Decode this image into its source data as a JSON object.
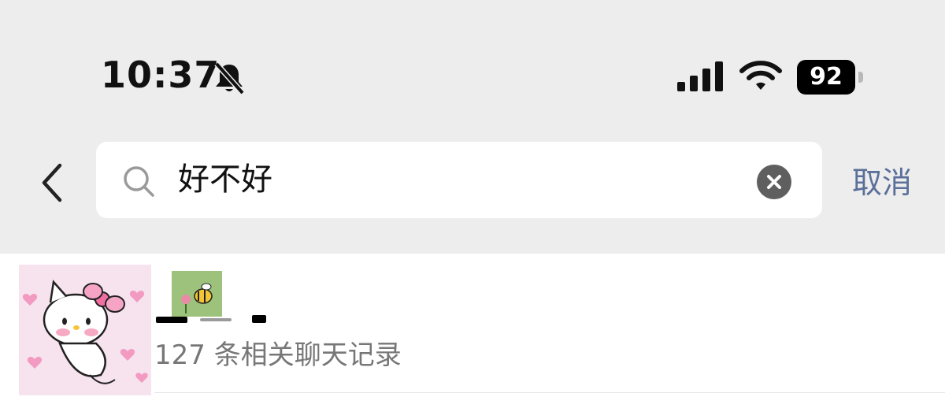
{
  "status_bar": {
    "time": "10:37",
    "battery_level": "92",
    "icons": [
      "bell-slash-icon",
      "cellular-signal-icon",
      "wifi-icon",
      "battery-icon"
    ]
  },
  "search": {
    "query": "好不好",
    "cancel_label": "取消",
    "icons": [
      "back-chevron-icon",
      "search-icon",
      "clear-icon"
    ]
  },
  "results": [
    {
      "record_count_text": "127 条相关聊天记录"
    }
  ],
  "colors": {
    "background": "#ededed",
    "cancel_text": "#5a6f99",
    "secondary_text": "#777777"
  }
}
